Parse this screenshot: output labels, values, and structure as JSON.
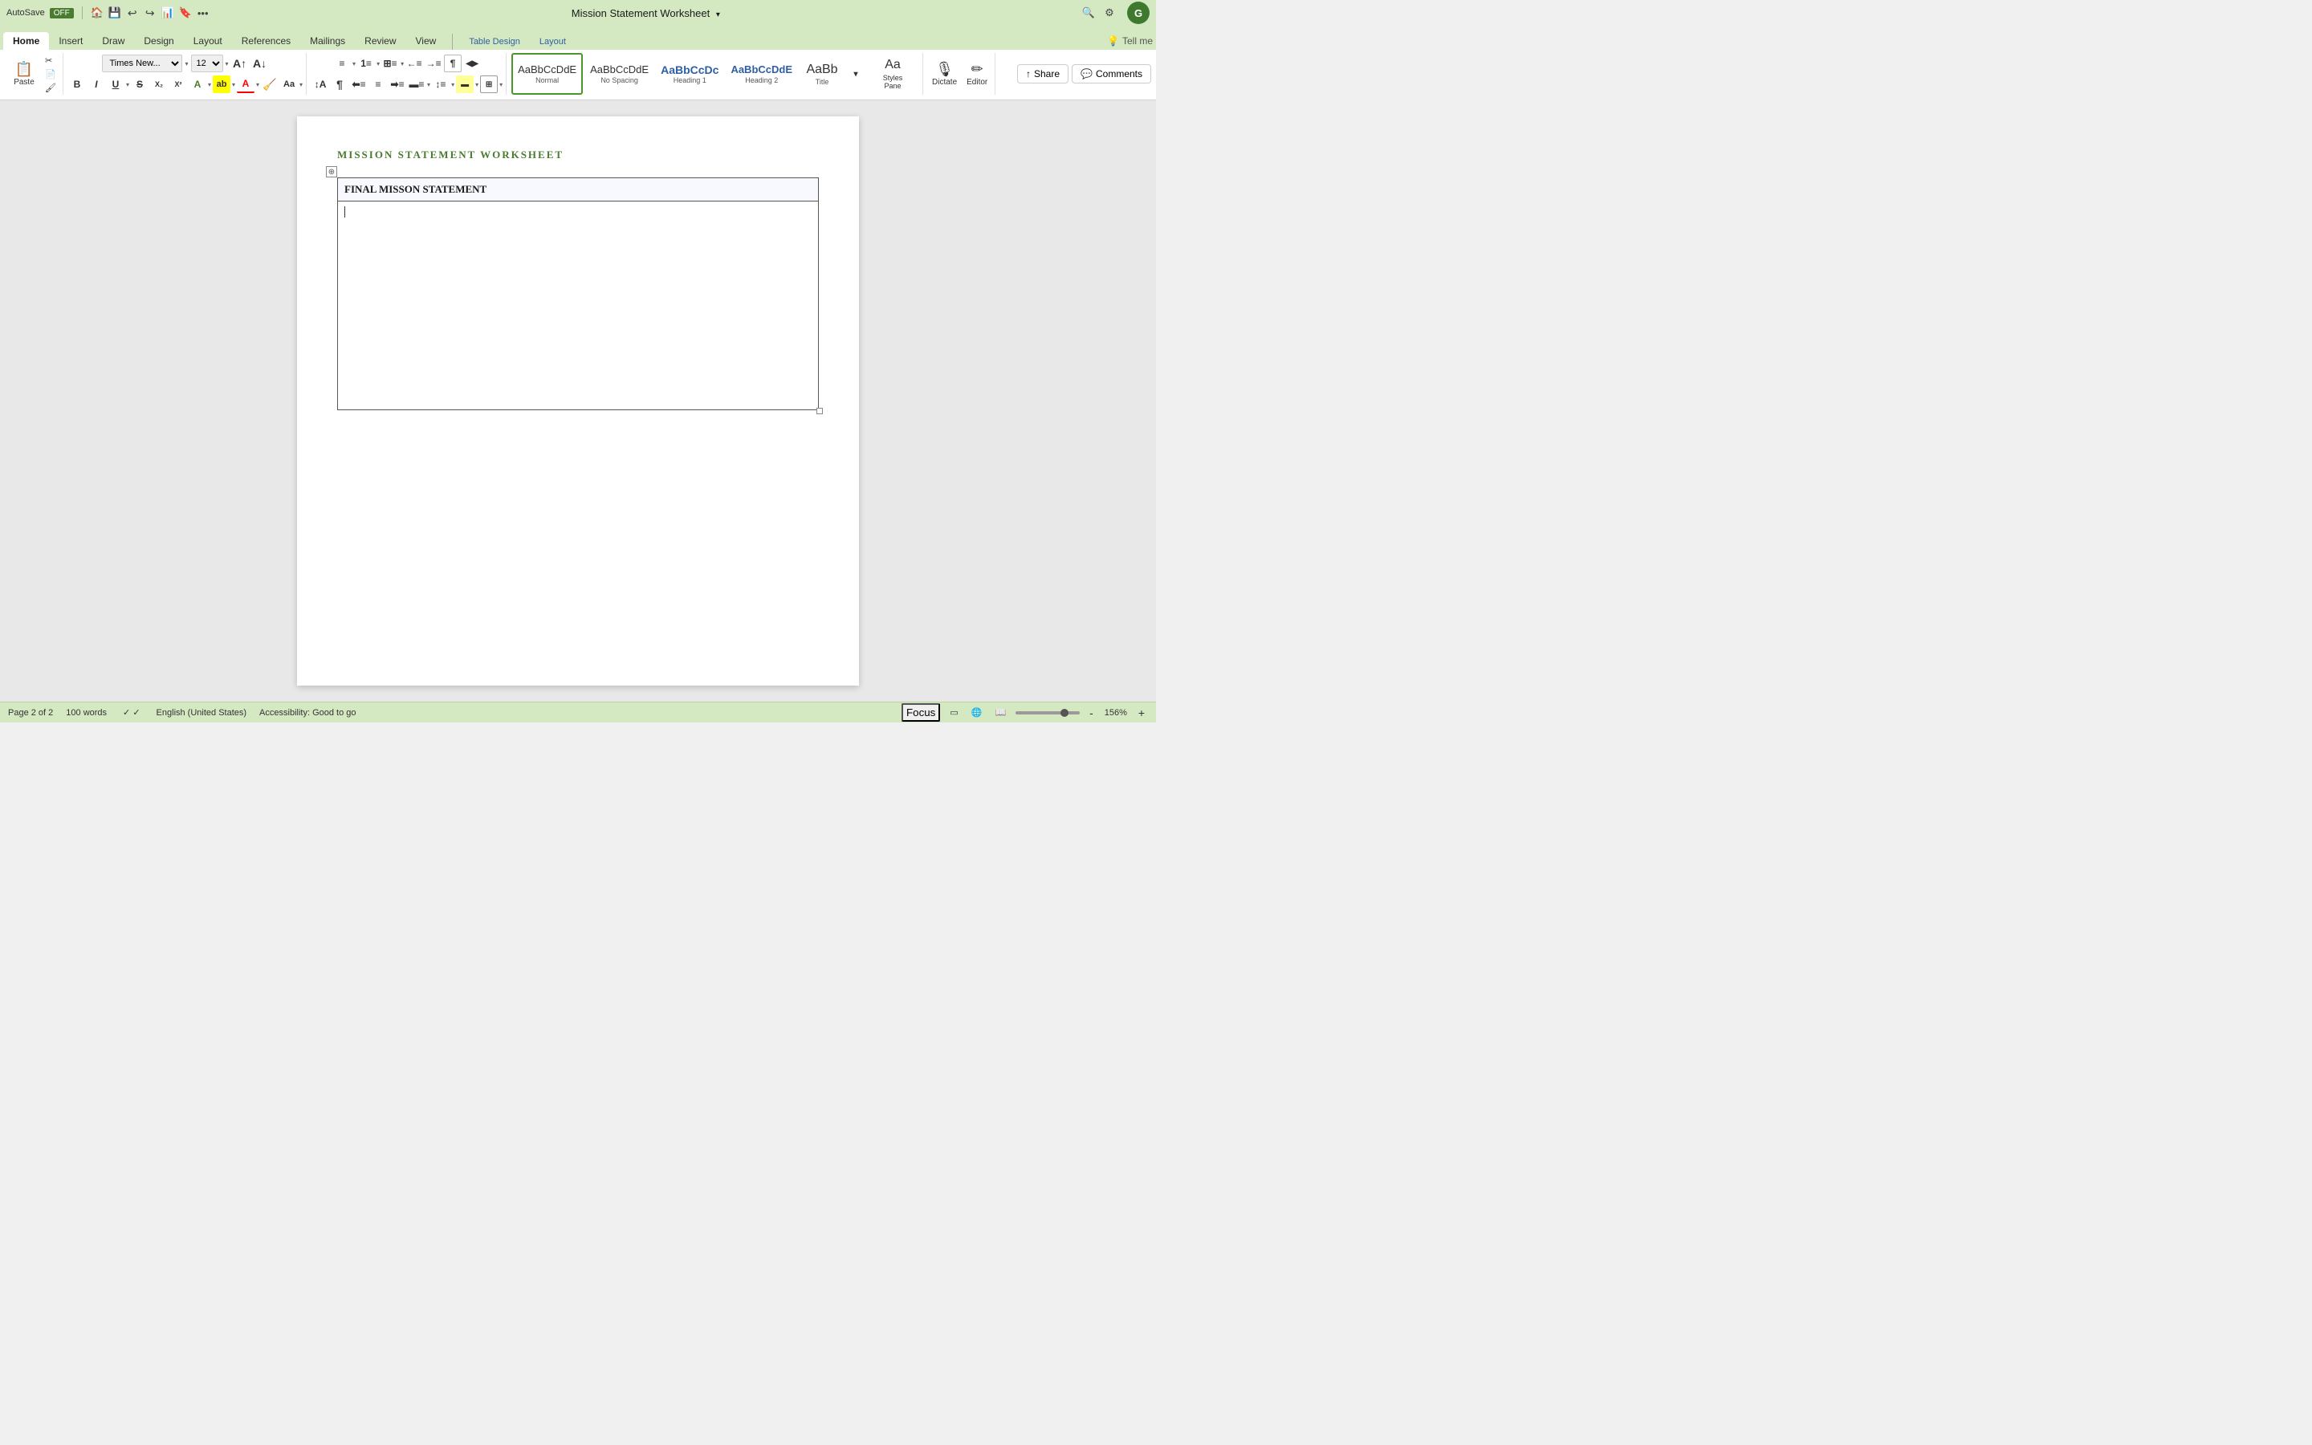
{
  "titleBar": {
    "autosave": "AutoSave",
    "autosave_state": "OFF",
    "title": "Mission Statement Worksheet",
    "icons": [
      "home",
      "save",
      "undo",
      "redo",
      "present",
      "bookmark",
      "more"
    ]
  },
  "ribbonTabs": {
    "tabs": [
      "Home",
      "Insert",
      "Draw",
      "Design",
      "Layout",
      "References",
      "Mailings",
      "Review",
      "View",
      "Table Design",
      "Layout"
    ],
    "active": "Home",
    "special_tabs": [
      "Table Design",
      "Layout"
    ],
    "tell_me": "Tell me"
  },
  "toolbar": {
    "paste_label": "Paste",
    "font_name": "Times New...",
    "font_size": "12",
    "styles": [
      {
        "name": "Normal",
        "label": "Normal",
        "preview": "AaBbCcDdE"
      },
      {
        "name": "No Spacing",
        "label": "No Spacing",
        "preview": "AaBbCcDdE"
      },
      {
        "name": "Heading 1",
        "label": "Heading 1",
        "preview": "AaBbCcDc"
      },
      {
        "name": "Heading 2",
        "label": "Heading 2",
        "preview": "AaBbCcDdE"
      },
      {
        "name": "Title",
        "label": "Title",
        "preview": "AaBb"
      }
    ],
    "styles_pane_label": "Styles Pane",
    "dictate_label": "Dictate",
    "editor_label": "Editor",
    "share_label": "Share",
    "comments_label": "Comments"
  },
  "document": {
    "title": "MISSION STATEMENT WORKSHEET",
    "table": {
      "header": "FINAL MISSON STATEMENT",
      "body": ""
    }
  },
  "statusBar": {
    "page_info": "Page 2 of 2",
    "word_count": "100 words",
    "spelling": "spelling check",
    "language": "English (United States)",
    "accessibility": "Accessibility: Good to go",
    "focus": "Focus",
    "view_icons": [
      "print-layout",
      "web-layout",
      "reader"
    ],
    "zoom_minus": "-",
    "zoom_plus": "+",
    "zoom_level": "156%"
  }
}
